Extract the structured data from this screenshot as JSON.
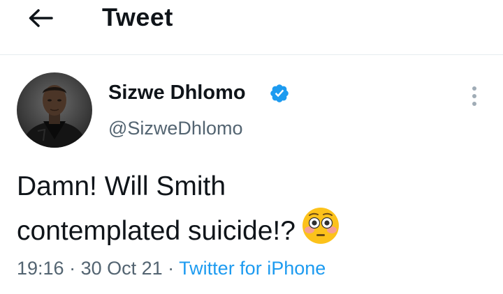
{
  "header": {
    "title": "Tweet"
  },
  "tweet": {
    "author_name": "Sizwe Dhlomo",
    "handle": "@SizweDhlomo",
    "text_line1": "Damn! Will Smith",
    "text_line2": "contemplated suicide!?",
    "time": "19:16",
    "separator": " · ",
    "date": "30 Oct 21",
    "source": "Twitter for iPhone",
    "verified": true
  },
  "icons": {
    "back": "back-arrow-icon",
    "verified": "verified-badge-icon",
    "more": "more-options-icon",
    "emoji": "flushed-face-emoji"
  },
  "colors": {
    "accent": "#1d9bf0",
    "text": "#0f1419",
    "secondary": "#536471",
    "divider": "#e6ecf0"
  }
}
